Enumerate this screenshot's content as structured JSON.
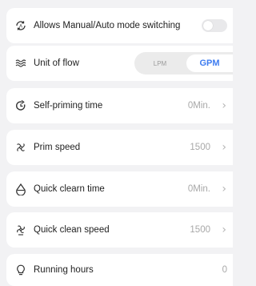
{
  "settings": {
    "mode_switch": {
      "label": "Allows Manual/Auto mode switching",
      "enabled": false,
      "icon": "auto-mode-icon"
    },
    "unit_of_flow": {
      "label": "Unit of flow",
      "options": [
        "LPM",
        "GPM"
      ],
      "selected": "GPM",
      "icon": "flow-wave-icon"
    },
    "self_priming_time": {
      "label": "Self-priming time",
      "value": "0Min.",
      "icon": "priming-refresh-icon"
    },
    "prim_speed": {
      "label": "Prim speed",
      "value": "1500",
      "icon": "speed-fan-icon"
    },
    "quick_clean_time": {
      "label": "Quick clearn time",
      "value": "0Min.",
      "icon": "water-drop-icon"
    },
    "quick_clean_speed": {
      "label": "Quick clean speed",
      "value": "1500",
      "icon": "clean-fan-icon"
    },
    "running_hours": {
      "label": "Running hours",
      "value": "0",
      "icon": "bulb-icon"
    }
  },
  "colors": {
    "accent": "#3e7cf0",
    "background": "#f2f2f4",
    "muted": "#a8a8a8"
  }
}
